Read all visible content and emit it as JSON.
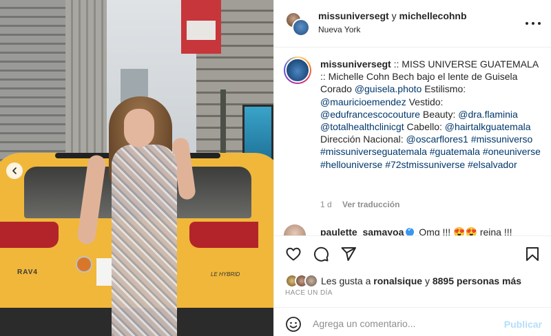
{
  "header": {
    "user1": "missuniversegt",
    "conjunction": "y",
    "user2": "michellecohnb",
    "location": "Nueva York"
  },
  "caption": {
    "username": "missuniversegt",
    "segments": [
      {
        "type": "text",
        "value": " :: MISS UNIVERSE GUATEMALA :: Michelle Cohn Bech bajo el lente de Guisela Corado "
      },
      {
        "type": "tag",
        "value": "@guisela.photo"
      },
      {
        "type": "text",
        "value": " Estilismo: "
      },
      {
        "type": "tag",
        "value": "@mauricioemendez"
      },
      {
        "type": "text",
        "value": " Vestido: "
      },
      {
        "type": "tag",
        "value": "@edufrancescocouture"
      },
      {
        "type": "text",
        "value": " Beauty: "
      },
      {
        "type": "tag",
        "value": "@dra.flaminia"
      },
      {
        "type": "text",
        "value": " "
      },
      {
        "type": "tag",
        "value": "@totalhealthclinicgt"
      },
      {
        "type": "text",
        "value": " Cabello: "
      },
      {
        "type": "tag",
        "value": "@hairtalkguatemala"
      },
      {
        "type": "text",
        "value": " Dirección Nacional: "
      },
      {
        "type": "tag",
        "value": "@oscarflores1"
      },
      {
        "type": "text",
        "value": " "
      },
      {
        "type": "tag",
        "value": "#missuniverso"
      },
      {
        "type": "text",
        "value": " "
      },
      {
        "type": "tag",
        "value": "#missuniverseguatemala"
      },
      {
        "type": "text",
        "value": " "
      },
      {
        "type": "tag",
        "value": "#guatemala"
      },
      {
        "type": "text",
        "value": " "
      },
      {
        "type": "tag",
        "value": "#oneuniverse"
      },
      {
        "type": "text",
        "value": " "
      },
      {
        "type": "tag",
        "value": "#hellouniverse"
      },
      {
        "type": "text",
        "value": " "
      },
      {
        "type": "tag",
        "value": "#72stmissuniverse"
      },
      {
        "type": "text",
        "value": " "
      },
      {
        "type": "tag",
        "value": "#elsalvador"
      }
    ],
    "time": "1 d",
    "translate_label": "Ver traducción"
  },
  "next_comment": {
    "username": "paulette_samayoa",
    "text": "Omg !!! 😍😍 reina !!!"
  },
  "likes": {
    "prefix": "Les gusta a",
    "user": "ronalsique",
    "connector": "y",
    "count": "8895 personas más"
  },
  "time_ago": "HACE UN DÍA",
  "comment_box": {
    "placeholder": "Agrega un comentario...",
    "publish_label": "Publicar"
  },
  "photo": {
    "car_model": "RAV4",
    "car_badge": "LE HYBRID"
  },
  "colors": {
    "link": "#00376b",
    "muted": "#8e8e8e",
    "publish_disabled": "#b2dffc"
  }
}
